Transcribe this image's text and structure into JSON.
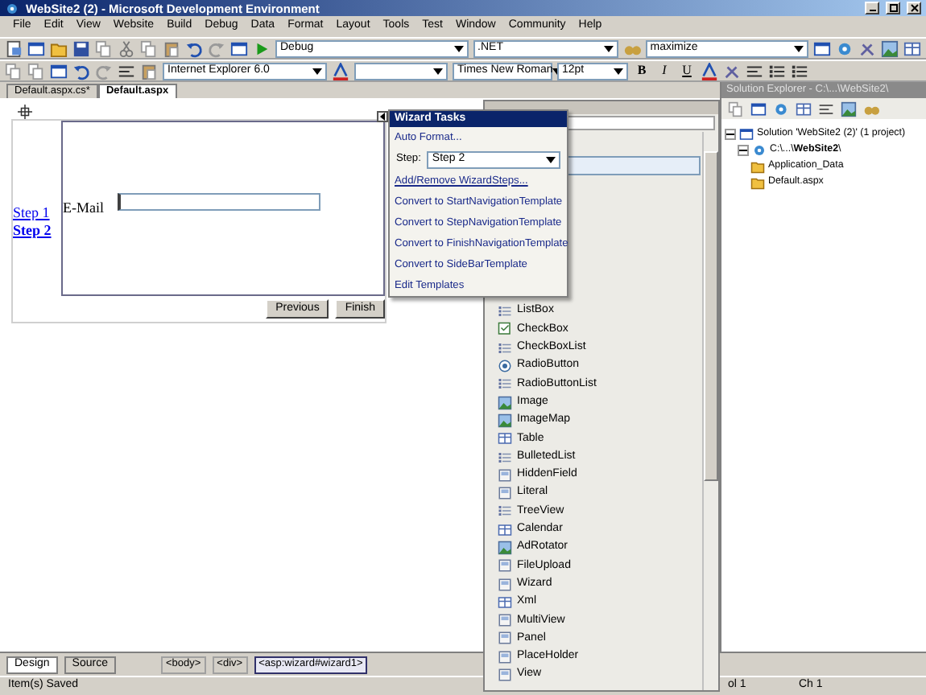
{
  "window": {
    "title": "WebSite2 (2) - Microsoft Development Environment"
  },
  "menu": [
    "File",
    "Edit",
    "View",
    "Website",
    "Build",
    "Debug",
    "Data",
    "Format",
    "Layout",
    "Tools",
    "Test",
    "Window",
    "Community",
    "Help"
  ],
  "toolbar1": {
    "configuration": "Debug",
    "platform": ".NET",
    "find": "maximize"
  },
  "toolbar2": {
    "target": "Internet Explorer 6.0",
    "font": "Times New Roman",
    "size": "12pt",
    "bold": "B",
    "italic": "I",
    "underline": "U"
  },
  "doc_tabs": [
    {
      "label": "Default.aspx.cs*",
      "selected": false
    },
    {
      "label": "Default.aspx",
      "selected": true
    }
  ],
  "designer": {
    "steps": [
      {
        "label": "Step 1",
        "selected": false
      },
      {
        "label": "Step 2",
        "selected": true
      }
    ],
    "field_label": "E-Mail",
    "buttons": [
      "Previous",
      "Finish"
    ]
  },
  "wizard_tasks": {
    "title": "Wizard Tasks",
    "items": [
      {
        "kind": "link",
        "label": "Auto Format...",
        "underlined": false
      },
      {
        "kind": "select",
        "label": "Step:",
        "value": "Step 2"
      },
      {
        "kind": "link",
        "label": "Add/Remove WizardSteps...",
        "underlined": true
      },
      {
        "kind": "link",
        "label": "Convert to StartNavigationTemplate",
        "underlined": false
      },
      {
        "kind": "link",
        "label": "Convert to StepNavigationTemplate",
        "underlined": false
      },
      {
        "kind": "link",
        "label": "Convert to FinishNavigationTemplate",
        "underlined": false
      },
      {
        "kind": "link",
        "label": "Convert to SideBarTemplate",
        "underlined": false
      },
      {
        "kind": "link",
        "label": "Edit Templates",
        "underlined": false
      }
    ]
  },
  "toolbox": {
    "items": [
      {
        "kind": "list",
        "label": "ListBox"
      },
      {
        "kind": "checkbox",
        "label": "CheckBox"
      },
      {
        "kind": "list",
        "label": "CheckBoxList"
      },
      {
        "kind": "radio",
        "label": "RadioButton"
      },
      {
        "kind": "list",
        "label": "RadioButtonList"
      },
      {
        "kind": "image",
        "label": "Image"
      },
      {
        "kind": "image",
        "label": "ImageMap"
      },
      {
        "kind": "table",
        "label": "Table"
      },
      {
        "kind": "list",
        "label": "BulletedList"
      },
      {
        "kind": "generic",
        "label": "HiddenField"
      },
      {
        "kind": "generic",
        "label": "Literal"
      },
      {
        "kind": "list",
        "label": "TreeView"
      },
      {
        "kind": "table",
        "label": "Calendar"
      },
      {
        "kind": "image",
        "label": "AdRotator"
      },
      {
        "kind": "generic",
        "label": "FileUpload"
      },
      {
        "kind": "generic",
        "label": "Wizard"
      },
      {
        "kind": "table",
        "label": "Xml"
      },
      {
        "kind": "generic",
        "label": "MultiView"
      },
      {
        "kind": "generic",
        "label": "Panel"
      },
      {
        "kind": "generic",
        "label": "PlaceHolder"
      },
      {
        "kind": "generic",
        "label": "View"
      }
    ]
  },
  "solution_explorer": {
    "title": "Solution Explorer - C:\\...\\WebSite2\\",
    "tree": [
      {
        "label": "Solution 'WebSite2 (2)' (1 project)",
        "expanded": true,
        "children": [
          {
            "label": "C:\\...\\**WebSite2**\\",
            "expanded": true,
            "children": [
              {
                "label": "Application_Data"
              },
              {
                "label": "Default.aspx"
              }
            ]
          }
        ]
      }
    ]
  },
  "view_tabs": [
    {
      "label": "Design",
      "selected": true
    },
    {
      "label": "Source",
      "selected": false
    }
  ],
  "breadcrumbs": [
    {
      "label": "<body>",
      "selected": false
    },
    {
      "label": "<div>",
      "selected": false
    },
    {
      "label": "<asp:wizard#wizard1>",
      "selected": true
    }
  ],
  "status_bar": {
    "message": "Item(s) Saved",
    "column": "ol 1",
    "char": "Ch 1"
  }
}
